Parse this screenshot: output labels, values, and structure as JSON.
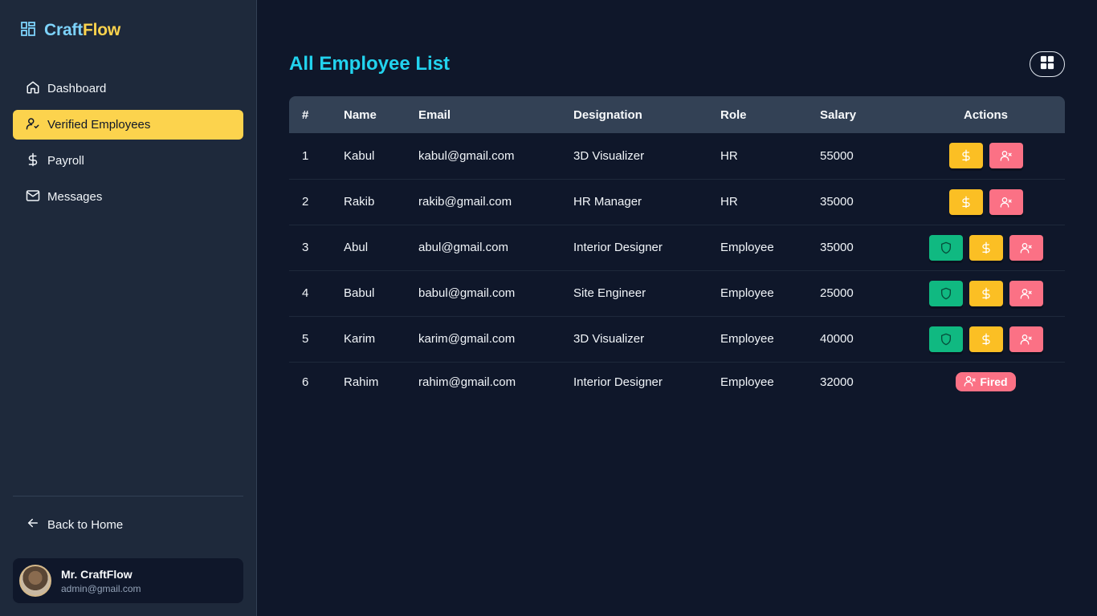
{
  "brand": {
    "part1": "Craft",
    "part2": "Flow"
  },
  "sidebar": {
    "items": [
      {
        "label": "Dashboard",
        "icon": "home-icon",
        "active": false
      },
      {
        "label": "Verified Employees",
        "icon": "user-check-icon",
        "active": true
      },
      {
        "label": "Payroll",
        "icon": "dollar-icon",
        "active": false
      },
      {
        "label": "Messages",
        "icon": "mail-icon",
        "active": false
      }
    ],
    "back_home": "Back to Home",
    "user": {
      "name": "Mr. CraftFlow",
      "email": "admin@gmail.com"
    }
  },
  "main": {
    "title": "All Employee List",
    "view_toggle_icon": "grid-icon",
    "table": {
      "headers": [
        "#",
        "Name",
        "Email",
        "Designation",
        "Role",
        "Salary",
        "Actions"
      ],
      "rows": [
        {
          "num": "1",
          "name": "Kabul",
          "email": "kabul@gmail.com",
          "designation": "3D Visualizer",
          "role": "HR",
          "salary": "55000",
          "actions": [
            "pay",
            "fire"
          ]
        },
        {
          "num": "2",
          "name": "Rakib",
          "email": "rakib@gmail.com",
          "designation": "HR Manager",
          "role": "HR",
          "salary": "35000",
          "actions": [
            "pay",
            "fire"
          ]
        },
        {
          "num": "3",
          "name": "Abul",
          "email": "abul@gmail.com",
          "designation": "Interior Designer",
          "role": "Employee",
          "salary": "35000",
          "actions": [
            "promote",
            "pay",
            "fire"
          ]
        },
        {
          "num": "4",
          "name": "Babul",
          "email": "babul@gmail.com",
          "designation": "Site Engineer",
          "role": "Employee",
          "salary": "25000",
          "actions": [
            "promote",
            "pay",
            "fire"
          ]
        },
        {
          "num": "5",
          "name": "Karim",
          "email": "karim@gmail.com",
          "designation": "3D Visualizer",
          "role": "Employee",
          "salary": "40000",
          "actions": [
            "promote",
            "pay",
            "fire"
          ]
        },
        {
          "num": "6",
          "name": "Rahim",
          "email": "rahim@gmail.com",
          "designation": "Interior Designer",
          "role": "Employee",
          "salary": "32000",
          "actions": [
            "fired"
          ]
        }
      ],
      "fired_label": "Fired"
    }
  },
  "colors": {
    "accent_yellow": "#fcd34d",
    "title_cyan": "#22d3ee",
    "btn_green": "#10b981",
    "btn_yellow": "#fbbf24",
    "btn_pink": "#fb7185"
  }
}
